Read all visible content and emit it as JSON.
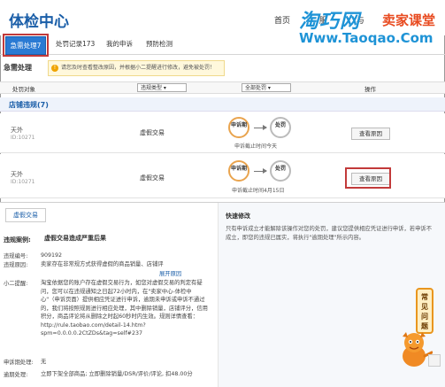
{
  "header": {
    "title": "体检中心",
    "nav_home": "首页",
    "nav_item2": "服",
    "nav_item3": "与",
    "watermark_cn": "淘巧网",
    "watermark_red": "卖家课堂",
    "watermark_url": "Www.Taoqao.Com"
  },
  "tabs": [
    {
      "label": "急需处理7"
    },
    {
      "label": "处罚记录173"
    },
    {
      "label": "我的申诉"
    },
    {
      "label": "预防检测"
    }
  ],
  "urgent": {
    "label": "急需处理",
    "notice": "请您及时查看整改原因，并根据小二提醒进行修改，避免被处罚！"
  },
  "table_header": {
    "col_object": "处罚对象",
    "col_type": "违规类型",
    "col_all": "全部处罚",
    "col_action": "操作"
  },
  "section": {
    "title": "店铺违规(7)"
  },
  "rows": [
    {
      "shop": "天外",
      "shop_id": "ID:10271",
      "type": "虚假交易",
      "step1": "申诉期",
      "step2": "处罚",
      "deadline": "申诉截止时间今天",
      "button": "查看原因"
    },
    {
      "shop": "天外",
      "shop_id": "ID:10271",
      "type": "虚假交易",
      "step1": "申诉期",
      "step2": "处罚",
      "deadline": "申诉截止时间4月15日",
      "button": "查看原因"
    }
  ],
  "detail": {
    "sub_tab": "虚假交易",
    "case_label": "违规案例:",
    "case_value": "虚假交易造成严重后果",
    "number_label": "违规编号:",
    "number_value": "909192",
    "reason_label": "违规原因:",
    "reason_value": "卖家存在非常规方式获得虚假的商品销量、店铺评",
    "reason_link": "展开原因",
    "note_label": "小二提醒:",
    "note_value": "淘宝依据您的账户存在虚假交易行为，如您对虚假交易的判定有疑问，您可以在违规通知之日起72小时内，在\"卖家中心-体检中心\"（申诉页面）提供相应凭证进行申诉，逾期未申诉或申诉不通过的，我们将按照规则进行相应处理，其中删除销量，店铺评分，信用积分，商品评论将从删除之时起60秒时内生效。规则详情查看： http://rule.taobao.com/detail-14.htm?spm=0.0.0.0.2CtZDs&tag=self#237",
    "punish_label": "申诉期处理:",
    "punish_value": "无",
    "overdue_label": "逾期处理:",
    "overdue_value": "立即下架全部商品; 立即删除销量/DSR/评价/评论, 扣48.00分"
  },
  "quick": {
    "title": "快速修改",
    "text": "只有申诉成立才能解除该操作对您的处罚，建议您提供相应凭证进行申诉，若申诉不成立，即您的违规已属实，将执行\"逾期处理\"所示内容。"
  },
  "faq": {
    "line1": "常",
    "line2": "见",
    "line3": "问",
    "line4": "题"
  }
}
